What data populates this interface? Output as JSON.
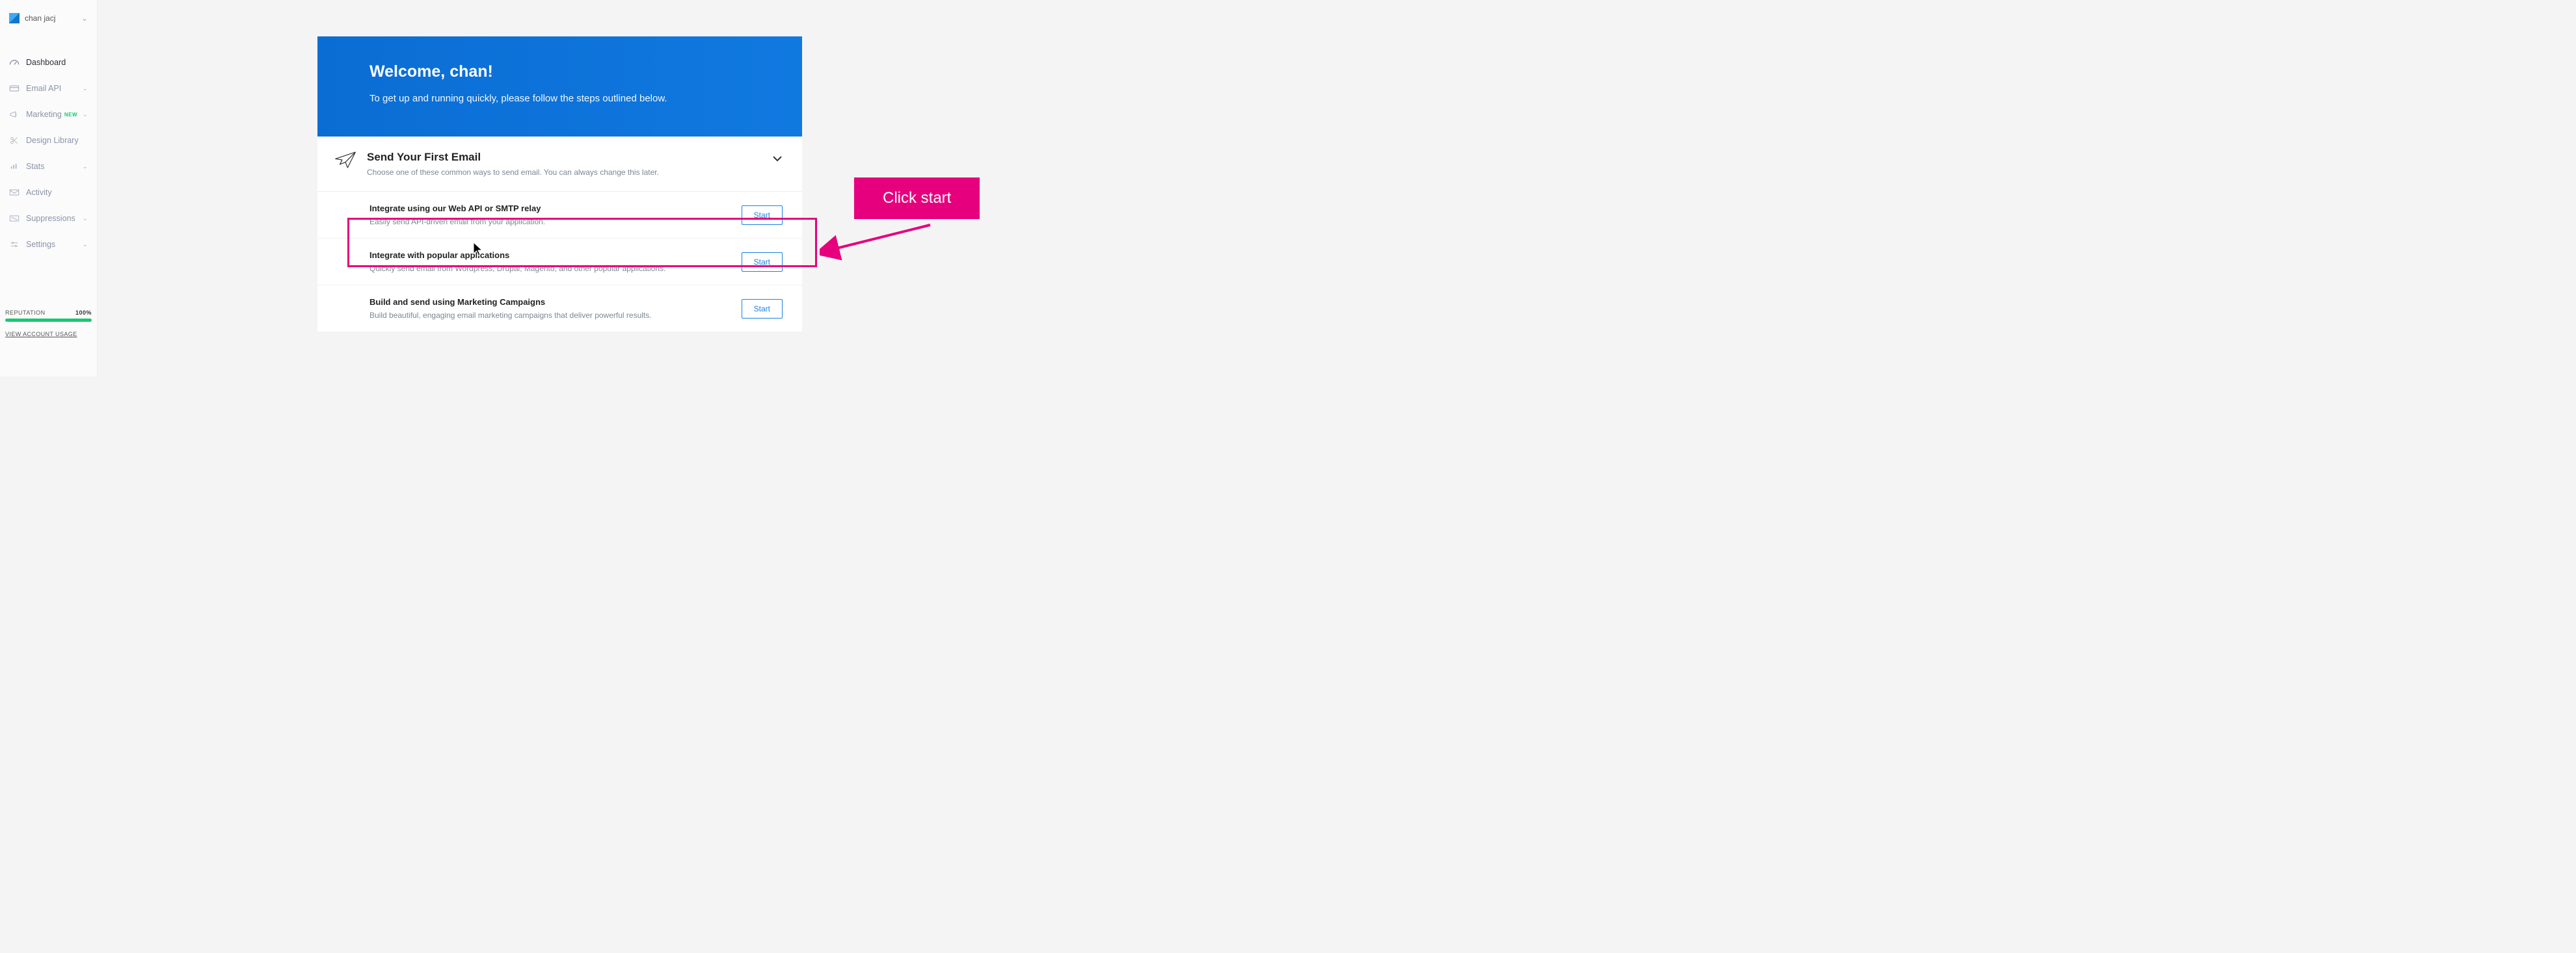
{
  "account": {
    "name": "chan jacj"
  },
  "nav": {
    "dashboard": "Dashboard",
    "email_api": "Email API",
    "marketing": "Marketing",
    "marketing_badge": "NEW",
    "design_library": "Design Library",
    "stats": "Stats",
    "activity": "Activity",
    "suppressions": "Suppressions",
    "settings": "Settings"
  },
  "sidebar_footer": {
    "reputation_label": "REPUTATION",
    "reputation_value": "100%",
    "view_usage": "VIEW ACCOUNT USAGE"
  },
  "hero": {
    "title": "Welcome, chan!",
    "subtitle": "To get up and running quickly, please follow the steps outlined below."
  },
  "panel": {
    "title": "Send Your First Email",
    "subtitle": "Choose one of these common ways to send email. You can always change this later."
  },
  "options": [
    {
      "title": "Integrate using our Web API or SMTP relay",
      "desc": "Easily send API-driven email from your application.",
      "button": "Start"
    },
    {
      "title": "Integrate with popular applications",
      "desc": "Quickly send email from Wordpress, Drupal, Magento, and other popular applications.",
      "button": "Start"
    },
    {
      "title": "Build and send using Marketing Campaigns",
      "desc": "Build beautiful, engaging email marketing campaigns that deliver powerful results.",
      "button": "Start"
    }
  ],
  "annotation": {
    "callout": "Click start"
  }
}
